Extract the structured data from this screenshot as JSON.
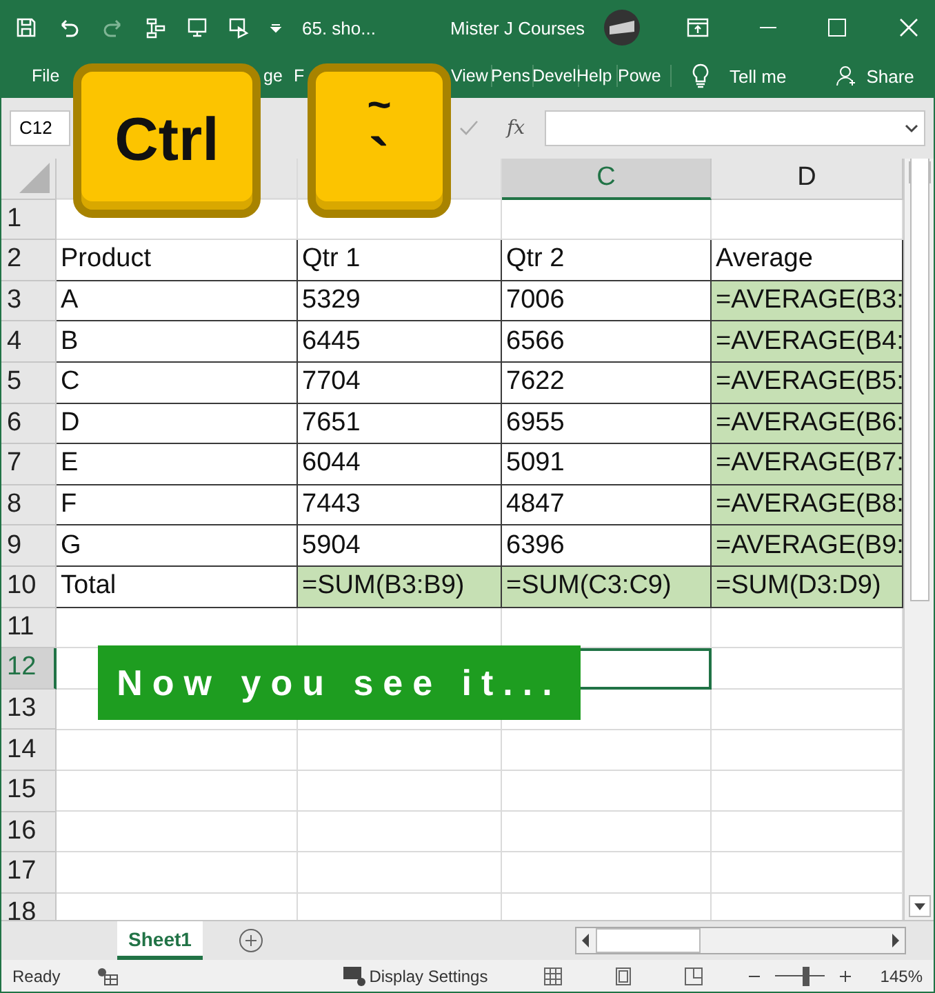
{
  "title_bar": {
    "document": "65. sho...",
    "account": "Mister J Courses"
  },
  "ribbon_tabs": [
    "File",
    "ge",
    "F",
    "View",
    "Pens",
    "Devel",
    "Help",
    "Powe"
  ],
  "tell_me": "Tell me",
  "share": "Share",
  "name_box": "C12",
  "fx": "fx",
  "columns": [
    {
      "label": "C",
      "selected": true
    },
    {
      "label": "D",
      "selected": false
    }
  ],
  "rows": [
    {
      "number": "1",
      "selected": false
    },
    {
      "number": "2",
      "selected": false,
      "cells": [
        {
          "text": "Product",
          "shaded": false
        },
        {
          "text": "Qtr 1",
          "shaded": false
        },
        {
          "text": "Qtr 2",
          "shaded": false
        },
        {
          "text": "Average",
          "shaded": false
        }
      ]
    },
    {
      "number": "3",
      "selected": false,
      "cells": [
        {
          "text": "A",
          "shaded": false
        },
        {
          "text": "5329",
          "shaded": false
        },
        {
          "text": "7006",
          "shaded": false
        },
        {
          "text": "=AVERAGE(B3:",
          "shaded": true
        }
      ]
    },
    {
      "number": "4",
      "selected": false,
      "cells": [
        {
          "text": "B",
          "shaded": false
        },
        {
          "text": "6445",
          "shaded": false
        },
        {
          "text": "6566",
          "shaded": false
        },
        {
          "text": "=AVERAGE(B4:",
          "shaded": true
        }
      ]
    },
    {
      "number": "5",
      "selected": false,
      "cells": [
        {
          "text": "C",
          "shaded": false
        },
        {
          "text": "7704",
          "shaded": false
        },
        {
          "text": "7622",
          "shaded": false
        },
        {
          "text": "=AVERAGE(B5:",
          "shaded": true
        }
      ]
    },
    {
      "number": "6",
      "selected": false,
      "cells": [
        {
          "text": "D",
          "shaded": false
        },
        {
          "text": "7651",
          "shaded": false
        },
        {
          "text": "6955",
          "shaded": false
        },
        {
          "text": "=AVERAGE(B6:",
          "shaded": true
        }
      ]
    },
    {
      "number": "7",
      "selected": false,
      "cells": [
        {
          "text": "E",
          "shaded": false
        },
        {
          "text": "6044",
          "shaded": false
        },
        {
          "text": "5091",
          "shaded": false
        },
        {
          "text": "=AVERAGE(B7:",
          "shaded": true
        }
      ]
    },
    {
      "number": "8",
      "selected": false,
      "cells": [
        {
          "text": "F",
          "shaded": false
        },
        {
          "text": "7443",
          "shaded": false
        },
        {
          "text": "4847",
          "shaded": false
        },
        {
          "text": "=AVERAGE(B8:",
          "shaded": true
        }
      ]
    },
    {
      "number": "9",
      "selected": false,
      "cells": [
        {
          "text": "G",
          "shaded": false
        },
        {
          "text": "5904",
          "shaded": false
        },
        {
          "text": "6396",
          "shaded": false
        },
        {
          "text": "=AVERAGE(B9:",
          "shaded": true
        }
      ]
    },
    {
      "number": "10",
      "selected": false,
      "cells": [
        {
          "text": "Total",
          "shaded": false
        },
        {
          "text": "=SUM(B3:B9)",
          "shaded": true
        },
        {
          "text": "=SUM(C3:C9)",
          "shaded": true
        },
        {
          "text": "=SUM(D3:D9)",
          "shaded": true
        }
      ]
    },
    {
      "number": "11",
      "selected": false
    },
    {
      "number": "12",
      "selected": true
    },
    {
      "number": "13",
      "selected": false
    },
    {
      "number": "14",
      "selected": false
    },
    {
      "number": "15",
      "selected": false
    },
    {
      "number": "16",
      "selected": false
    },
    {
      "number": "17",
      "selected": false
    },
    {
      "number": "18",
      "selected": false
    }
  ],
  "keys": [
    {
      "label": "Ctrl"
    },
    {
      "label": "`",
      "shift_label": "~"
    }
  ],
  "banner": "Now you see it...",
  "sheet_tabs": [
    {
      "label": "Sheet1",
      "selected": true
    }
  ],
  "status_bar": {
    "state": "Ready",
    "display_settings": "Display Settings",
    "zoom": "145%",
    "zoom_slider": {
      "level": 0.62
    }
  }
}
